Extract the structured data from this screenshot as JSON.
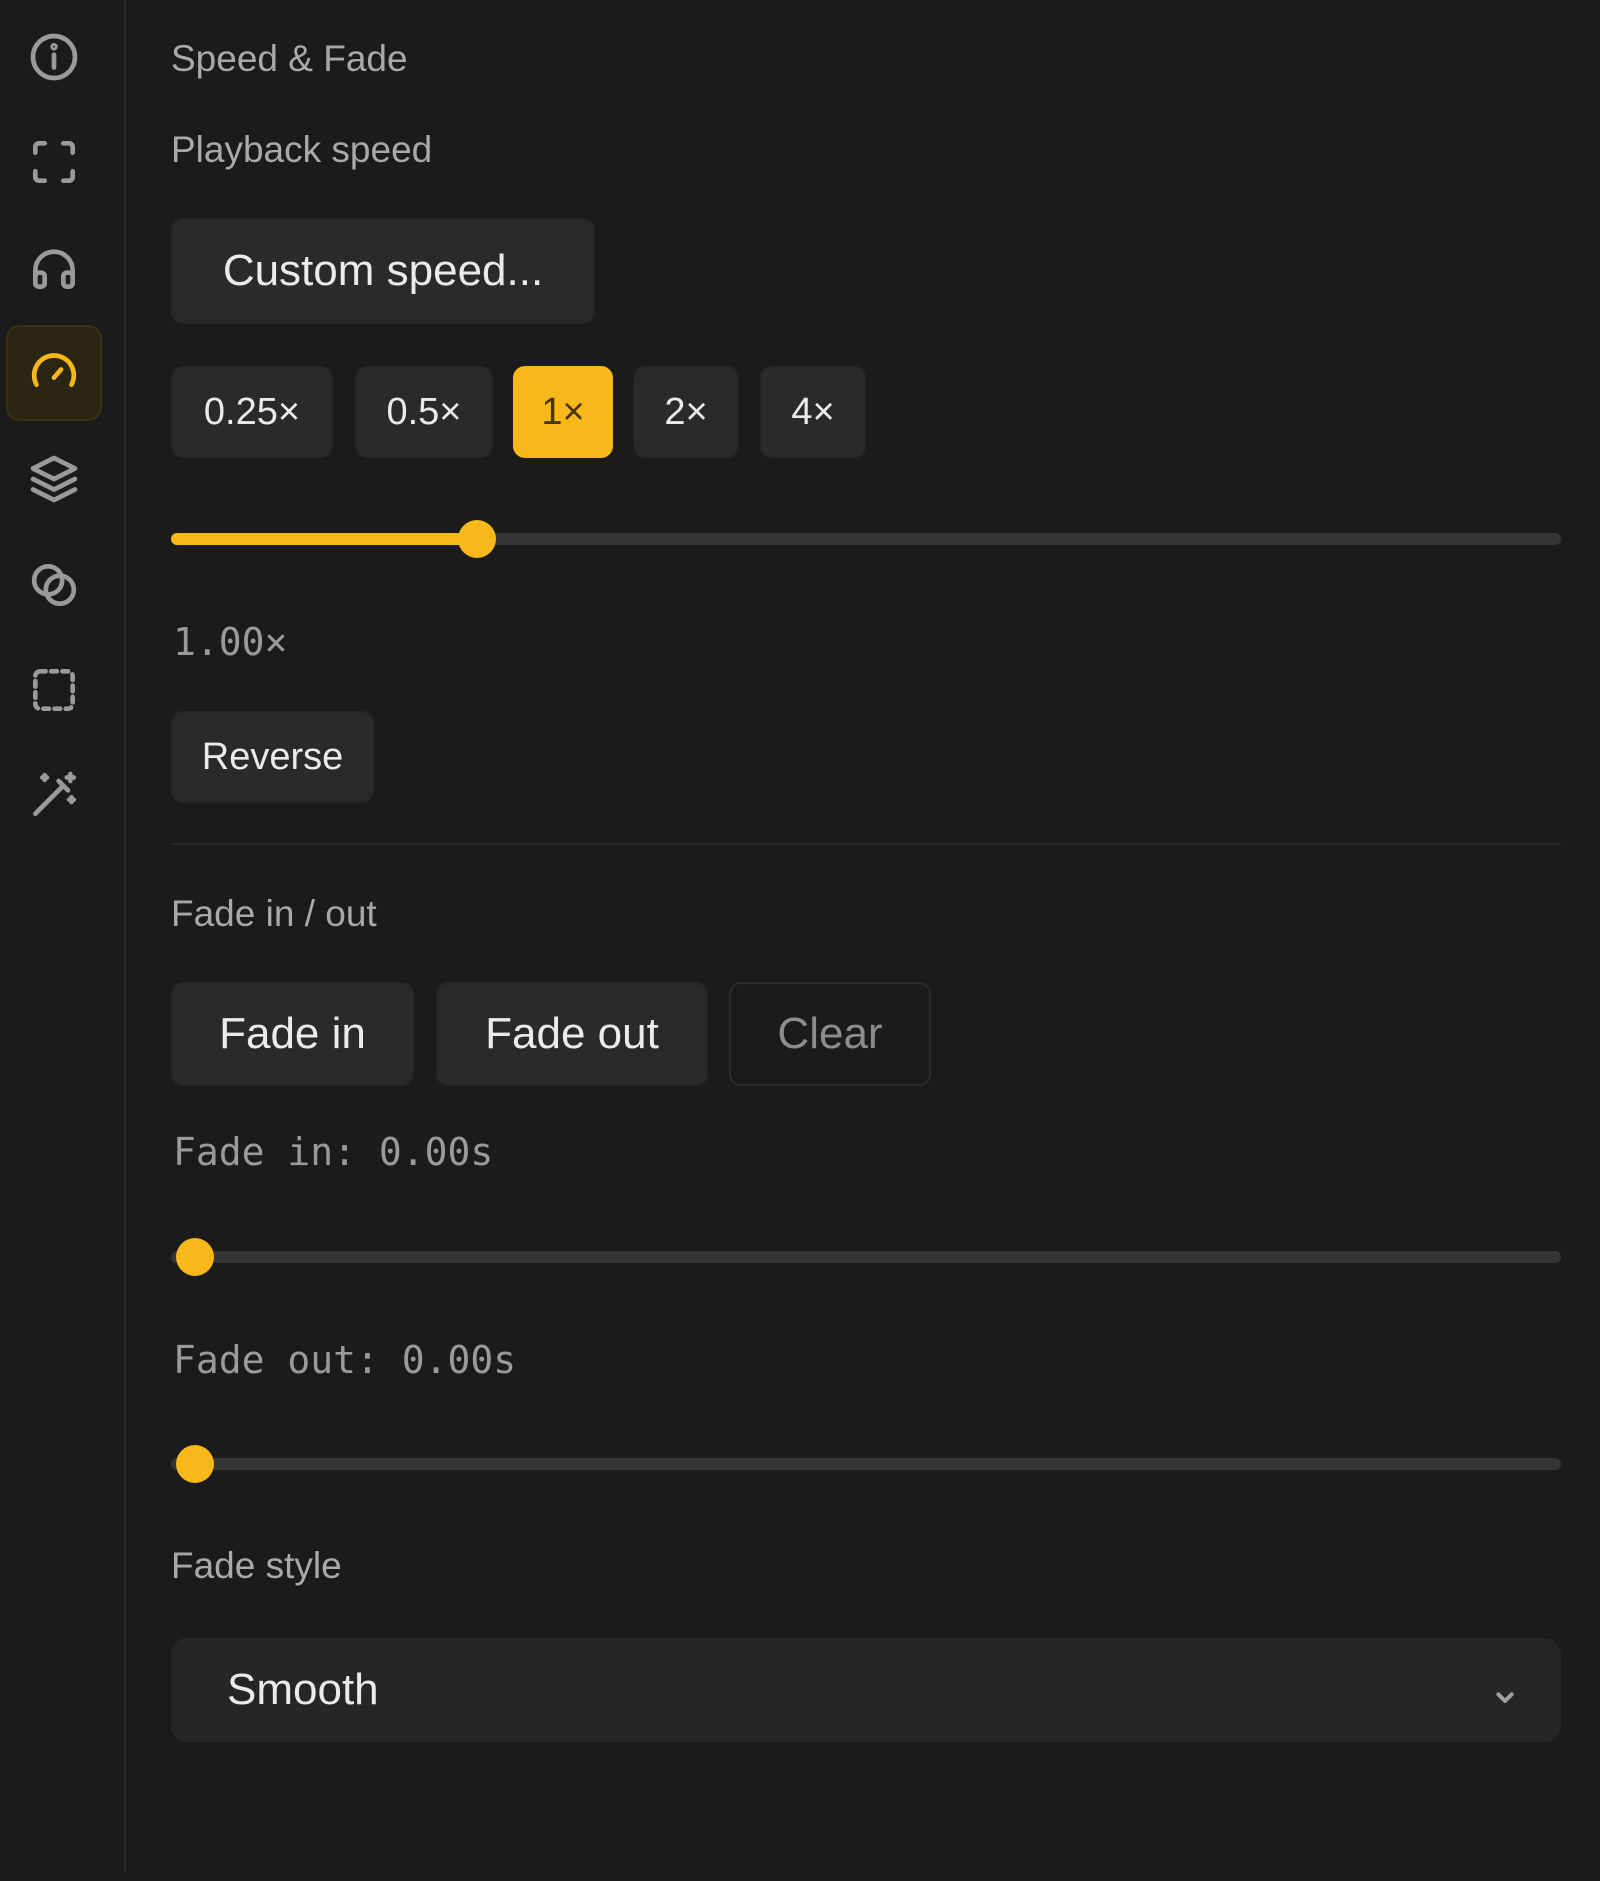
{
  "sidebar": {
    "items": [
      {
        "name": "info-icon",
        "active": false
      },
      {
        "name": "fullscreen-icon",
        "active": false
      },
      {
        "name": "headphones-icon",
        "active": false
      },
      {
        "name": "speedometer-icon",
        "active": true
      },
      {
        "name": "layers-icon",
        "active": false
      },
      {
        "name": "blend-circles-icon",
        "active": false
      },
      {
        "name": "dashed-square-icon",
        "active": false
      },
      {
        "name": "magic-wand-icon",
        "active": false
      }
    ]
  },
  "panel": {
    "title": "Speed & Fade",
    "playback": {
      "label": "Playback speed",
      "custom_button": "Custom speed...",
      "presets": [
        "0.25×",
        "0.5×",
        "1×",
        "2×",
        "4×"
      ],
      "selected_preset": "1×",
      "slider_fraction": 0.21,
      "value_readout": "1.00×",
      "reverse_button": "Reverse"
    },
    "fade": {
      "label": "Fade in / out",
      "fade_in_button": "Fade in",
      "fade_out_button": "Fade out",
      "clear_button": "Clear",
      "fade_in_readout": "Fade in: 0.00s",
      "fade_in_fraction": 0,
      "fade_out_readout": "Fade out: 0.00s",
      "fade_out_fraction": 0,
      "style_label": "Fade style",
      "style_value": "Smooth"
    }
  },
  "colors": {
    "accent": "#f7b81a",
    "background": "#1b1b1b",
    "button": "#2a2a2a"
  }
}
